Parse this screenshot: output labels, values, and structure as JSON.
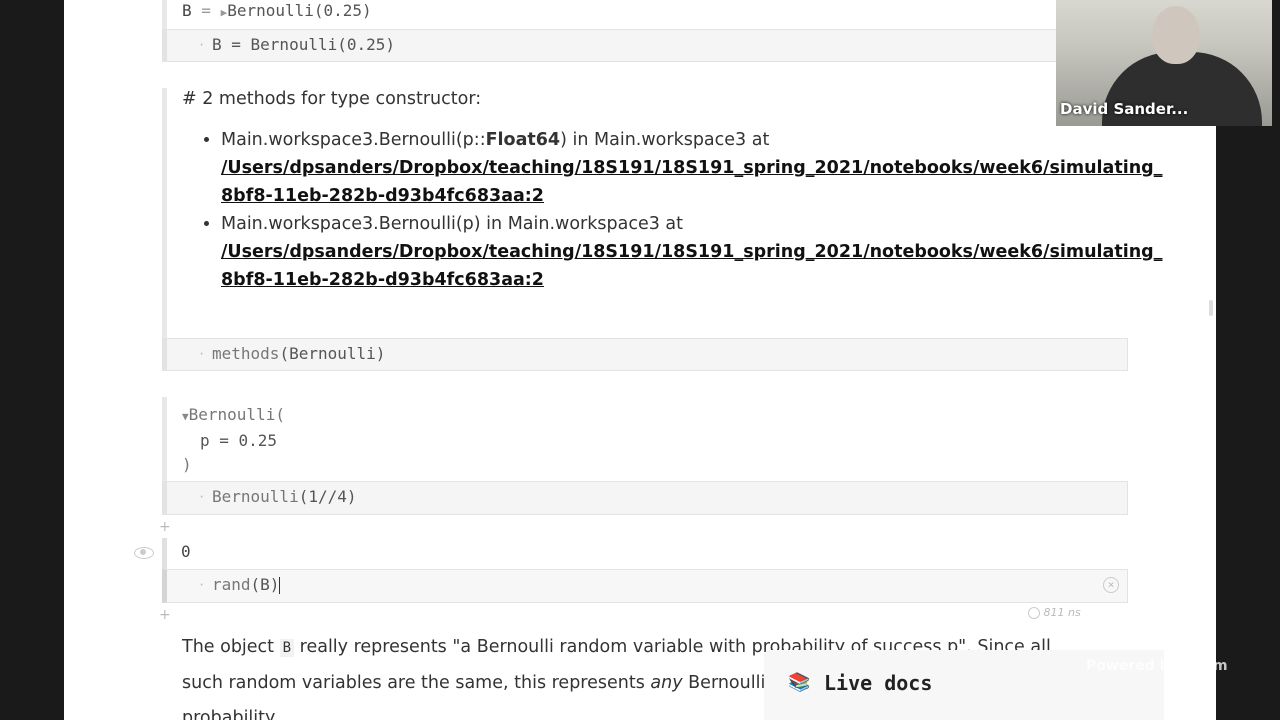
{
  "cell1": {
    "output_var": "B",
    "output_eq": "=",
    "output_value": "Bernoulli(0.25)",
    "code": "B = Bernoulli(0.25)"
  },
  "cell2": {
    "heading": "# 2 methods for type constructor:",
    "methods": [
      {
        "sig_pre": "Main.workspace3.Bernoulli(p::",
        "sig_bold": "Float64",
        "sig_post": ") in Main.workspace3 at",
        "path_line1": "/Users/dpsanders/Dropbox/teaching/18S191/18S191_spring_2021/notebooks/week6/simulating_",
        "path_line2": "8bf8-11eb-282b-d93b4fc683aa:2"
      },
      {
        "sig_pre": "Main.workspace3.Bernoulli(p) in Main.workspace3 at",
        "sig_bold": "",
        "sig_post": "",
        "path_line1": "/Users/dpsanders/Dropbox/teaching/18S191/18S191_spring_2021/notebooks/week6/simulating_",
        "path_line2": "8bf8-11eb-282b-d93b4fc683aa:2"
      }
    ],
    "code_fn": "methods",
    "code_arg": "(Bernoulli)"
  },
  "cell3": {
    "out_line1": "Bernoulli(",
    "out_line2": "p = 0.25",
    "out_line3": ")",
    "code_fn": "Bernoulli",
    "code_arg": "(1//4)"
  },
  "cell4": {
    "output": "0",
    "code_fn": "rand",
    "code_arg": "(B)",
    "runtime": "811 ns"
  },
  "prose": {
    "line1_a": "The object",
    "line1_code": "B",
    "line1_b": "really represents \"a Bernoulli random variable with probability of success p\". Since all",
    "line2_a": "such random variables are the same, this represents",
    "line2_em": "any",
    "line2_b": "Bernoulli random variable with that",
    "line3": "probability."
  },
  "webcam": {
    "name": "David Sander..."
  },
  "overlay": {
    "live_docs": "Live docs",
    "live_docs_icon": "book-icon",
    "zoom_watermark": "Powered by Zoom"
  }
}
